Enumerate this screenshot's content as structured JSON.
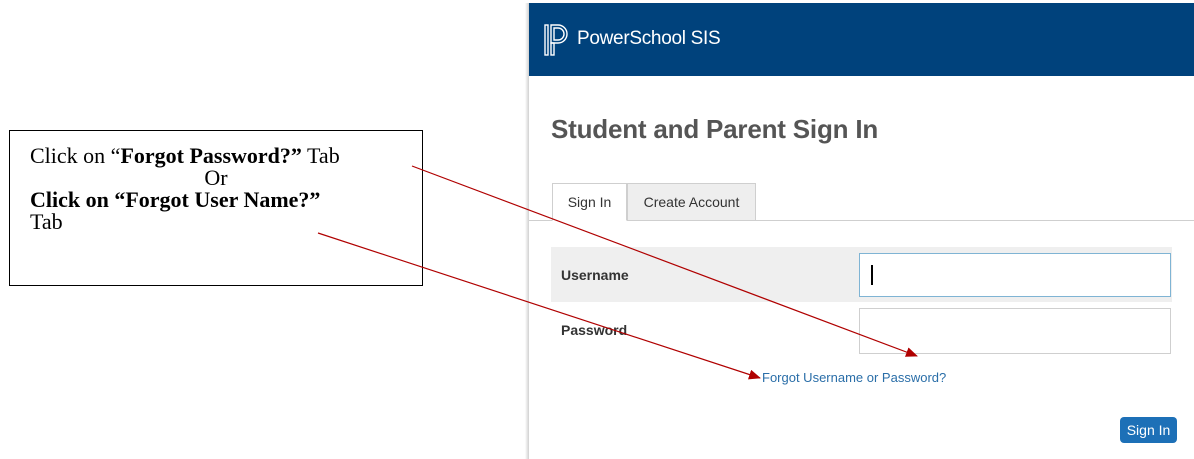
{
  "callout": {
    "line1_prefix": "Click on “",
    "line1_bold": "Forgot Password?”",
    "line1_suffix": " Tab",
    "line2": "Or",
    "line3_bold": "Click on “Forgot User Name?”",
    "line4": "Tab"
  },
  "header": {
    "brand": "PowerSchool SIS",
    "logo_icon": "powerschool-p-logo",
    "background_color": "#00427c"
  },
  "main": {
    "title": "Student and Parent Sign In",
    "tabs": [
      {
        "label": "Sign In",
        "active": true
      },
      {
        "label": "Create Account",
        "active": false
      }
    ],
    "form": {
      "username_label": "Username",
      "username_value": "",
      "password_label": "Password",
      "password_value": "",
      "forgot_link": "Forgot Username or Password?",
      "submit_label": "Sign In"
    }
  },
  "colors": {
    "accent": "#1d70b7",
    "annotation_arrow": "#b00000"
  }
}
